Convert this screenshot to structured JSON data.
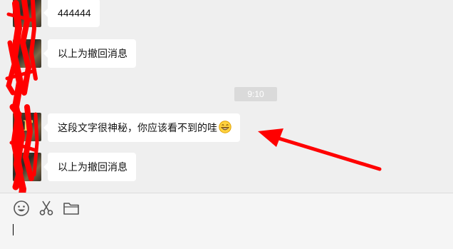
{
  "messages": [
    {
      "text": "444444"
    },
    {
      "text": "以上为撤回消息"
    },
    {
      "text": "这段文字很神秘，你应该看不到的哇"
    },
    {
      "text": "以上为撤回消息"
    }
  ],
  "timestamp": "9:10",
  "emoji": "grin-emoji",
  "toolbar": {
    "icons": [
      "smiley-icon",
      "scissors-icon",
      "folder-icon"
    ]
  },
  "annotations": {
    "arrow_color": "#ff0000",
    "redaction_color": "#ff0000"
  },
  "input": {
    "value": ""
  }
}
